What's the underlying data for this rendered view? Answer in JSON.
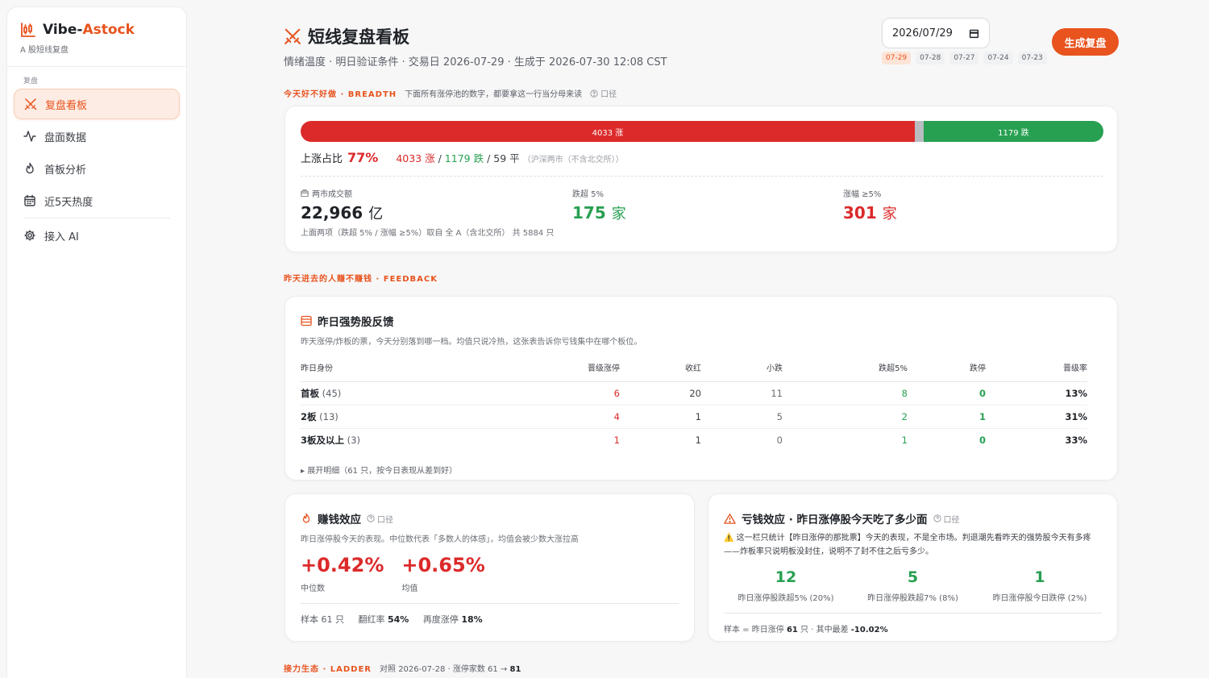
{
  "sidebar": {
    "brand_prefix": "Vibe-",
    "brand_accent": "Astock",
    "brand_sub": "A 股短线复盘",
    "group_label": "复盘",
    "items": [
      {
        "label": "复盘看板",
        "icon": "swords-icon",
        "active": true
      },
      {
        "label": "盘面数据",
        "icon": "activity-icon",
        "active": false
      },
      {
        "label": "首板分析",
        "icon": "flame-icon",
        "active": false
      },
      {
        "label": "近5天热度",
        "icon": "calendar-icon",
        "active": false
      }
    ],
    "extra_item": {
      "label": "接入 AI",
      "icon": "gear-icon"
    }
  },
  "header": {
    "title": "短线复盘看板",
    "subtitle": "情绪温度 · 明日验证条件 · 交易日 2026-07-29 · 生成于 2026-07-30 12:08 CST",
    "date_value": "2026/07/29",
    "date_tabs": [
      "07-29",
      "07-28",
      "07-27",
      "07-24",
      "07-23"
    ],
    "generate_label": "生成复盘"
  },
  "breadth": {
    "section_title": "今天好不好做 · BREADTH",
    "section_desc": "下面所有涨停池的数字，都要拿这一行当分母来读",
    "caliber_label": "口径",
    "up_count": 4033,
    "flat_count": 59,
    "down_count": 1179,
    "bar_up_text": "4033 涨",
    "bar_down_text": "1179 跌",
    "ratio_label": "上涨占比",
    "ratio_value": "77%",
    "up_text": "4033 涨",
    "down_text": "1179 跌",
    "flat_text": "/ 59 平",
    "sep": "/",
    "scope_note": "（沪深两市（不含北交所））",
    "turnover_label": "两市成交额",
    "turnover_value": "22,966",
    "turnover_unit": "亿",
    "drop5_label": "跌超 5%",
    "drop5_value": "175",
    "drop5_unit": "家",
    "rise5_label": "涨幅 ≥5%",
    "rise5_value": "301",
    "rise5_unit": "家",
    "note": "上面两项（跌超 5% / 涨幅 ≥5%）取自 全 A（含北交所） 共 5884 只"
  },
  "feedback": {
    "section_title": "昨天进去的人赚不赚钱 · FEEDBACK",
    "card_title": "昨日强势股反馈",
    "card_desc": "昨天涨停/炸板的票，今天分别落到哪一档。均值只说冷热，这张表告诉你亏钱集中在哪个板位。",
    "columns": [
      "昨日身份",
      "晋级涨停",
      "收红",
      "小跌",
      "跌超5%",
      "跌停",
      "晋级率"
    ],
    "rows": [
      {
        "name": "首板",
        "count": "(45)",
        "promote": "6",
        "red": "20",
        "small_drop": "11",
        "drop5": "8",
        "limit_down": "0",
        "rate": "13%"
      },
      {
        "name": "2板",
        "count": "(13)",
        "promote": "4",
        "red": "1",
        "small_drop": "5",
        "drop5": "2",
        "limit_down": "1",
        "rate": "31%"
      },
      {
        "name": "3板及以上",
        "count": "(3)",
        "promote": "1",
        "red": "1",
        "small_drop": "0",
        "drop5": "1",
        "limit_down": "0",
        "rate": "33%"
      }
    ],
    "expand_label": "▸ 展开明细（61 只，按今日表现从差到好）"
  },
  "money": {
    "title": "赚钱效应",
    "caliber_label": "口径",
    "desc": "昨日涨停股今天的表现。中位数代表「多数人的体感」，均值会被少数大涨拉高",
    "median_value": "+0.42%",
    "median_label": "中位数",
    "mean_value": "+0.65%",
    "mean_label": "均值",
    "sample_label": "样本 61 只",
    "turn_red_label": "翻红率",
    "turn_red_value": "54%",
    "relimit_label": "再度涨停",
    "relimit_value": "18%"
  },
  "loss": {
    "title": "亏钱效应 · 昨日涨停股今天吃了多少面",
    "caliber_label": "口径",
    "desc": "⚠️ 这一栏只统计【昨日涨停的那批票】今天的表现，不是全市场。判退潮先看昨天的强势股今天有多疼——炸板率只说明板没封住，说明不了封不住之后亏多少。",
    "stats": [
      {
        "value": "12",
        "label": "昨日涨停股跌超5% (20%)"
      },
      {
        "value": "5",
        "label": "昨日涨停股跌超7% (8%)"
      },
      {
        "value": "1",
        "label": "昨日涨停股今日跌停 (2%)"
      }
    ],
    "footer_prefix": "样本 = 昨日涨停",
    "footer_count": "61",
    "footer_mid": "只 · 其中最差",
    "footer_worst": "-10.02%"
  },
  "ladder": {
    "section_title": "接力生态 · LADDER",
    "desc": "对照 2026-07-28 · 涨停家数 61 →",
    "value": "81"
  },
  "colors": {
    "accent": "#e8531e",
    "up": "#dc2a2a",
    "down": "#28a052"
  }
}
